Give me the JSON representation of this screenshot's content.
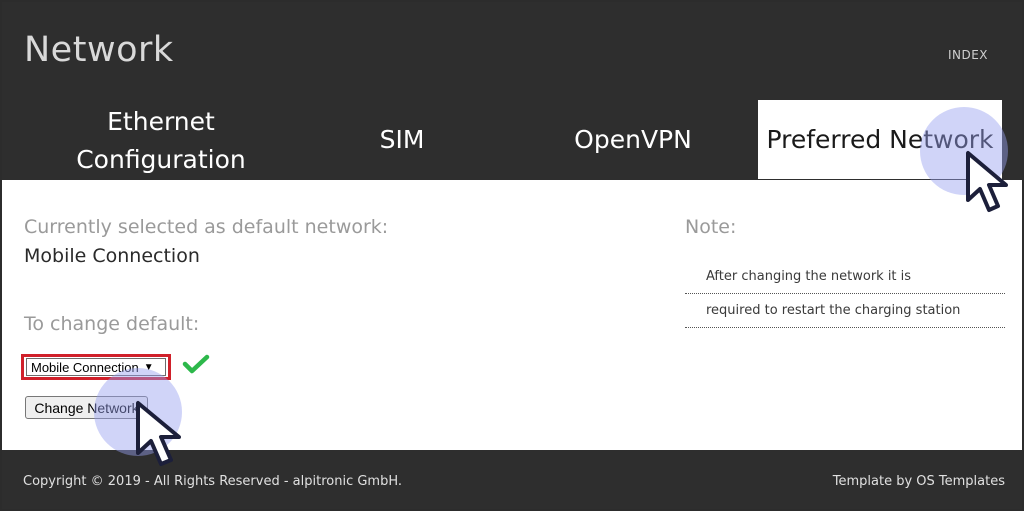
{
  "header": {
    "title": "Network",
    "index_link": "INDEX"
  },
  "tabs": [
    {
      "label": "Ethernet Configuration",
      "active": false
    },
    {
      "label": "SIM",
      "active": false
    },
    {
      "label": "OpenVPN",
      "active": false
    },
    {
      "label": "Preferred Network",
      "active": true
    }
  ],
  "main": {
    "current_label": "Currently selected as default network:",
    "current_value": "Mobile Connection",
    "change_label": "To change default:",
    "select_value": "Mobile Connection",
    "button_label": "Change Network"
  },
  "note": {
    "title": "Note:",
    "lines": [
      "After changing the network it is",
      "required to restart the charging station"
    ]
  },
  "footer": {
    "copyright": "Copyright © 2019 - All Rights Reserved - alpitronic GmbH.",
    "credit": "Template by OS Templates"
  },
  "colors": {
    "header_bg": "#2e2e2e",
    "highlight": "#d0202a",
    "check": "#2db84b",
    "pointer_halo": "#9aa0f0"
  },
  "icons": {
    "check": "check-icon",
    "pointer": "cursor-pointer-icon"
  }
}
